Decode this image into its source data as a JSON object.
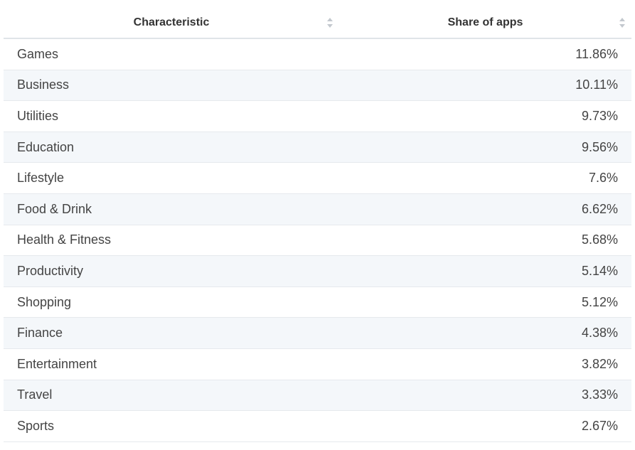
{
  "chart_data": {
    "type": "table",
    "columns": [
      "Characteristic",
      "Share of apps"
    ],
    "rows": [
      {
        "category": "Games",
        "value": "11.86%"
      },
      {
        "category": "Business",
        "value": "10.11%"
      },
      {
        "category": "Utilities",
        "value": "9.73%"
      },
      {
        "category": "Education",
        "value": "9.56%"
      },
      {
        "category": "Lifestyle",
        "value": "7.6%"
      },
      {
        "category": "Food & Drink",
        "value": "6.62%"
      },
      {
        "category": "Health & Fitness",
        "value": "5.68%"
      },
      {
        "category": "Productivity",
        "value": "5.14%"
      },
      {
        "category": "Shopping",
        "value": "5.12%"
      },
      {
        "category": "Finance",
        "value": "4.38%"
      },
      {
        "category": "Entertainment",
        "value": "3.82%"
      },
      {
        "category": "Travel",
        "value": "3.33%"
      },
      {
        "category": "Sports",
        "value": "2.67%"
      }
    ]
  },
  "colors": {
    "header_border": "#e0e4e8",
    "stripe": "#f4f7fa",
    "text": "#444444",
    "sort_icon": "#c3c8ce"
  },
  "icons": {
    "sort": "sort-icon"
  }
}
